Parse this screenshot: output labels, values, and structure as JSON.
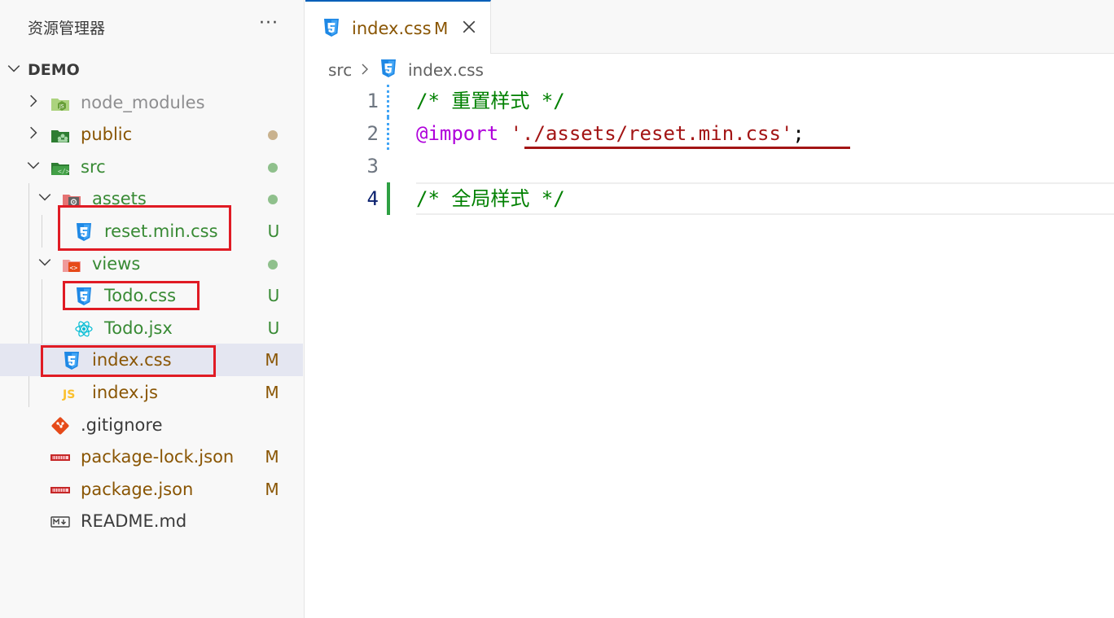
{
  "explorer": {
    "title": "资源管理器",
    "more": "···",
    "root": "DEMO",
    "items": [
      {
        "label": "node_modules",
        "status": "",
        "color": "#8e8e90"
      },
      {
        "label": "public",
        "status": "dot",
        "color": "#895503"
      },
      {
        "label": "src",
        "status": "dot",
        "color": "#388a34"
      },
      {
        "label": "assets",
        "status": "dot",
        "color": "#388a34"
      },
      {
        "label": "reset.min.css",
        "status": "U",
        "color": "#388a34"
      },
      {
        "label": "views",
        "status": "dot",
        "color": "#388a34"
      },
      {
        "label": "Todo.css",
        "status": "U",
        "color": "#388a34"
      },
      {
        "label": "Todo.jsx",
        "status": "U",
        "color": "#388a34"
      },
      {
        "label": "index.css",
        "status": "M",
        "color": "#895503"
      },
      {
        "label": "index.js",
        "status": "M",
        "color": "#895503"
      },
      {
        "label": ".gitignore",
        "status": "",
        "color": "#3b3b3b"
      },
      {
        "label": "package-lock.json",
        "status": "M",
        "color": "#895503"
      },
      {
        "label": "package.json",
        "status": "M",
        "color": "#895503"
      },
      {
        "label": "README.md",
        "status": "",
        "color": "#3b3b3b"
      }
    ]
  },
  "tab": {
    "label": "index.css",
    "modified": "M"
  },
  "breadcrumb": {
    "folder": "src",
    "file": "index.css"
  },
  "editor": {
    "lines": [
      {
        "no": "1",
        "comment": "/* 重置样式 */"
      },
      {
        "no": "2",
        "keyword": "@import",
        "string": "'./assets/reset.min.css'",
        "punc": ";"
      },
      {
        "no": "3"
      },
      {
        "no": "4",
        "comment": "/* 全局样式 */"
      }
    ]
  }
}
